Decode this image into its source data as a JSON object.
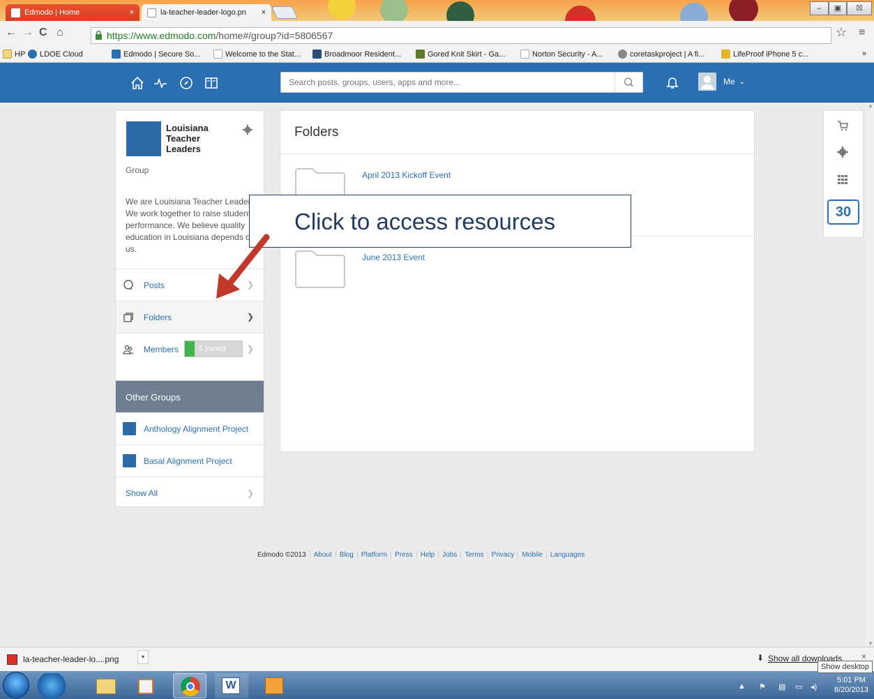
{
  "browser": {
    "tabs": [
      {
        "title": "Edmodo | Home",
        "close": "×"
      },
      {
        "title": "la-teacher-leader-logo.pn",
        "close": "×"
      }
    ],
    "window_close": "☒",
    "url_secure": "https://www.edmodo.com",
    "url_rest": "/home#/group?id=5806567",
    "bookmarks": [
      {
        "label": "HP"
      },
      {
        "label": "LDOE Cloud"
      },
      {
        "label": "Edmodo | Secure So..."
      },
      {
        "label": "Welcome to the Stat..."
      },
      {
        "label": "Broadmoor Resident..."
      },
      {
        "label": "Gored Knit Skirt - Ga..."
      },
      {
        "label": "Norton Security - A..."
      },
      {
        "label": "coretaskproject | A fi..."
      },
      {
        "label": "LifeProof iPhone 5 c..."
      }
    ],
    "bookmarks_overflow": "»"
  },
  "topnav": {
    "search_placeholder": "Search posts, groups, users, apps and more...",
    "me_label": "Me"
  },
  "group": {
    "name": "Louisiana Teacher Leaders",
    "type": "Group",
    "description": "We are Louisiana Teacher Leaders. We work together to raise student performance. We believe quality education in Louisiana depends on us.",
    "nav": [
      {
        "label": "Posts"
      },
      {
        "label": "Folders"
      },
      {
        "label": "Members"
      }
    ],
    "members_badge": "5 joined"
  },
  "other_groups": {
    "header": "Other Groups",
    "items": [
      {
        "label": "Anthology Alignment Project"
      },
      {
        "label": "Basal Alignment Project"
      }
    ],
    "show_all": "Show All"
  },
  "main": {
    "title": "Folders",
    "folders": [
      {
        "label": "April 2013 Kickoff Event"
      },
      {
        "label": "June 2013 Event"
      }
    ]
  },
  "sidebar_right": {
    "calendar_day": "30"
  },
  "callout": {
    "text": "Click to access resources"
  },
  "footer": {
    "copyright": "Edmodo ©2013",
    "links": [
      "About",
      "Blog",
      "Platform",
      "Press",
      "Help",
      "Jobs",
      "Terms",
      "Privacy",
      "Mobile",
      "Languages"
    ]
  },
  "downloads": {
    "file": "la-teacher-leader-lo....png",
    "show_all": "Show all downloads",
    "close": "×",
    "tooltip": "Show desktop"
  },
  "taskbar": {
    "time": "5:01 PM",
    "date": "8/20/2013"
  },
  "colors": {
    "edmodo_blue": "#2a6fb2",
    "badge_green": "#3db54a",
    "callout_navy": "#1f3b5f",
    "arrow_red": "#c0392b"
  }
}
